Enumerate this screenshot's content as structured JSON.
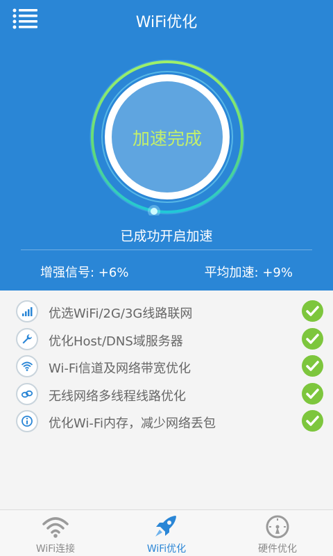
{
  "header": {
    "title": "WiFi优化",
    "menu_icon": "list-menu-icon"
  },
  "gauge": {
    "center_text": "加速完成",
    "progress_fraction": 1.0,
    "ring_color": "#7ed957",
    "center_color": "#5fa5e0",
    "text_color": "#c4f06a"
  },
  "status_text": "已成功开启加速",
  "stats": {
    "signal": "增强信号: +6%",
    "speed": "平均加速: +9%"
  },
  "items": [
    {
      "label": "优选WiFi/2G/3G线路联网",
      "icon": "signal-bars-icon",
      "done": true
    },
    {
      "label": "优化Host/DNS域服务器",
      "icon": "wrench-icon",
      "done": true
    },
    {
      "label": "Wi-Fi信道及网络带宽优化",
      "icon": "wifi-icon",
      "done": true
    },
    {
      "label": "无线网络多线程线路优化",
      "icon": "link-icon",
      "done": true
    },
    {
      "label": "优化Wi-Fi内存，减少网络丢包",
      "icon": "info-icon",
      "done": true
    }
  ],
  "nav": [
    {
      "label": "WiFi连接",
      "icon": "wifi-icon",
      "active": false
    },
    {
      "label": "WiFi优化",
      "icon": "rocket-icon",
      "active": true
    },
    {
      "label": "硬件优化",
      "icon": "speedometer-icon",
      "active": false
    }
  ],
  "colors": {
    "header_bg": "#2a86d6",
    "check_green": "#7dc63d",
    "active_tab": "#2a86d6"
  }
}
